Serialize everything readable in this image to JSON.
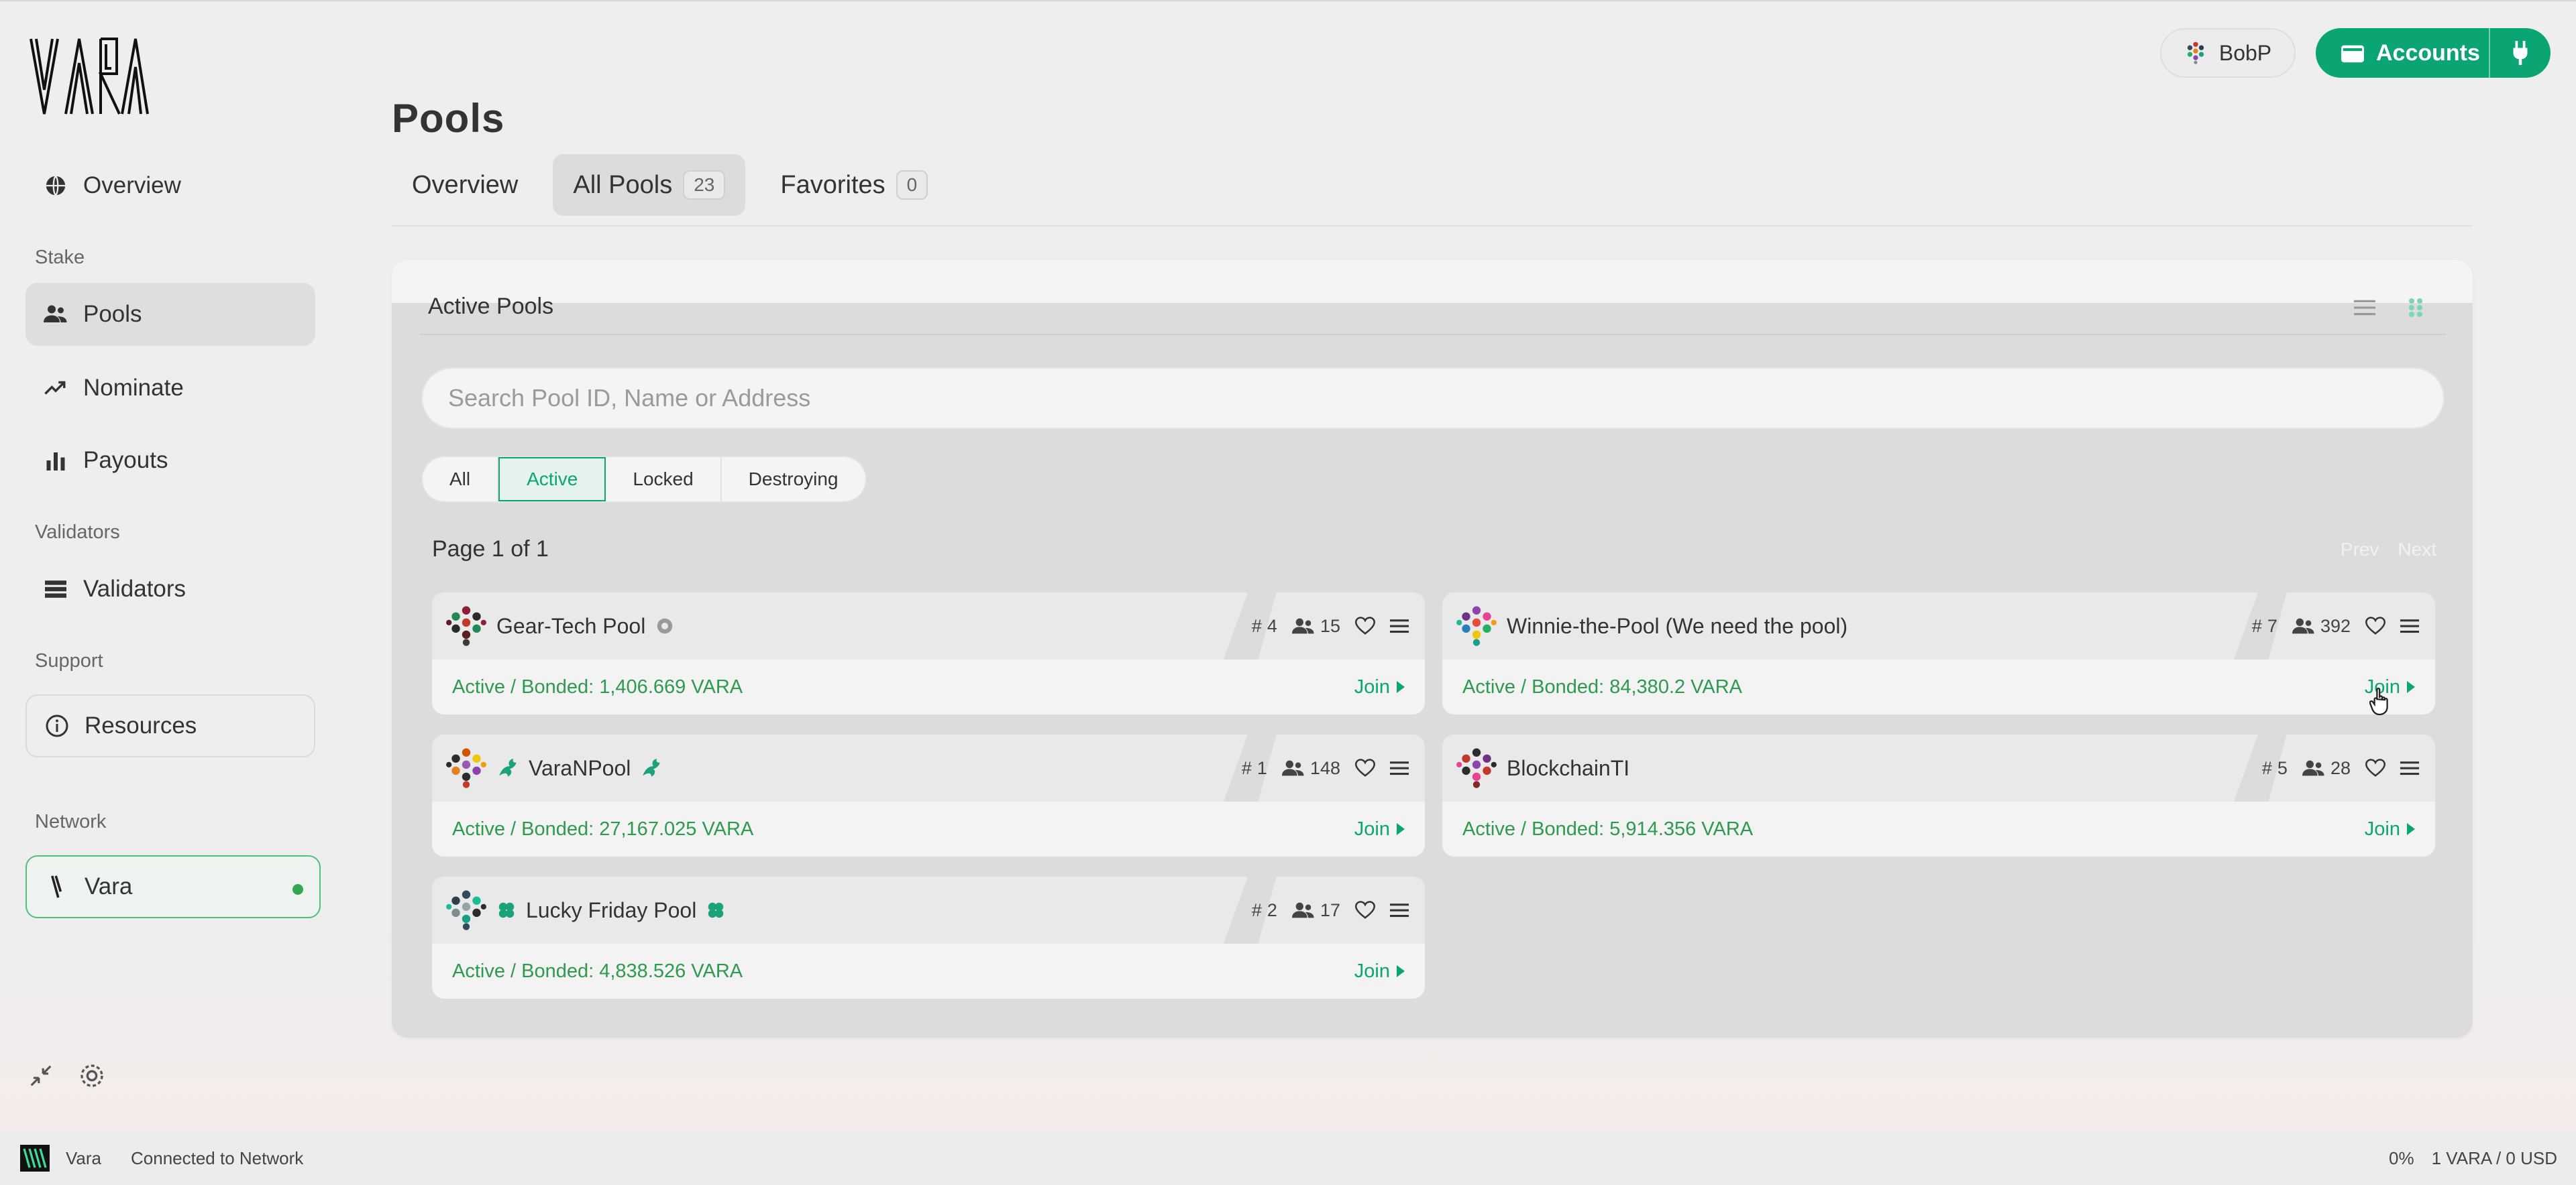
{
  "app": {
    "brand": "Vara"
  },
  "sidebar": {
    "overview": "Overview",
    "section_stake": "Stake",
    "pools": "Pools",
    "nominate": "Nominate",
    "payouts": "Payouts",
    "section_validators": "Validators",
    "validators": "Validators",
    "section_support": "Support",
    "resources": "Resources",
    "section_network": "Network",
    "network_name": "Vara",
    "network_status_color": "#32a852"
  },
  "header": {
    "account_name": "BobP",
    "accounts_label": "Accounts",
    "accent_color": "#0aa573"
  },
  "page": {
    "title": "Pools",
    "tabs": [
      {
        "label": "Overview",
        "count": ""
      },
      {
        "label": "All Pools",
        "count": "23"
      },
      {
        "label": "Favorites",
        "count": "0"
      }
    ]
  },
  "panel": {
    "title": "Active Pools",
    "search_placeholder": "Search Pool ID, Name or Address",
    "filters": [
      "All",
      "Active",
      "Locked",
      "Destroying"
    ],
    "active_filter": "Active",
    "page_info": "Page 1 of 1",
    "prev": "Prev",
    "next": "Next"
  },
  "pools": [
    {
      "name": "Gear-Tech Pool",
      "id": "4",
      "members": "15",
      "status": "Active / Bonded: 1,406.669 VARA",
      "join": "Join"
    },
    {
      "name": "Winnie-the-Pool (We need the pool)",
      "id": "7",
      "members": "392",
      "status": "Active / Bonded: 84,380.2 VARA",
      "join": "Join"
    },
    {
      "name": "VaraNPool",
      "id": "1",
      "members": "148",
      "status": "Active / Bonded: 27,167.025 VARA",
      "join": "Join"
    },
    {
      "name": "BlockchainTI",
      "id": "5",
      "members": "28",
      "status": "Active / Bonded: 5,914.356 VARA",
      "join": "Join"
    },
    {
      "name": "Lucky Friday Pool",
      "id": "2",
      "members": "17",
      "status": "Active / Bonded: 4,838.526 VARA",
      "join": "Join"
    }
  ],
  "statusbar": {
    "network": "Vara",
    "connection": "Connected to Network",
    "percent": "0%",
    "price": "1 VARA / 0 USD"
  }
}
